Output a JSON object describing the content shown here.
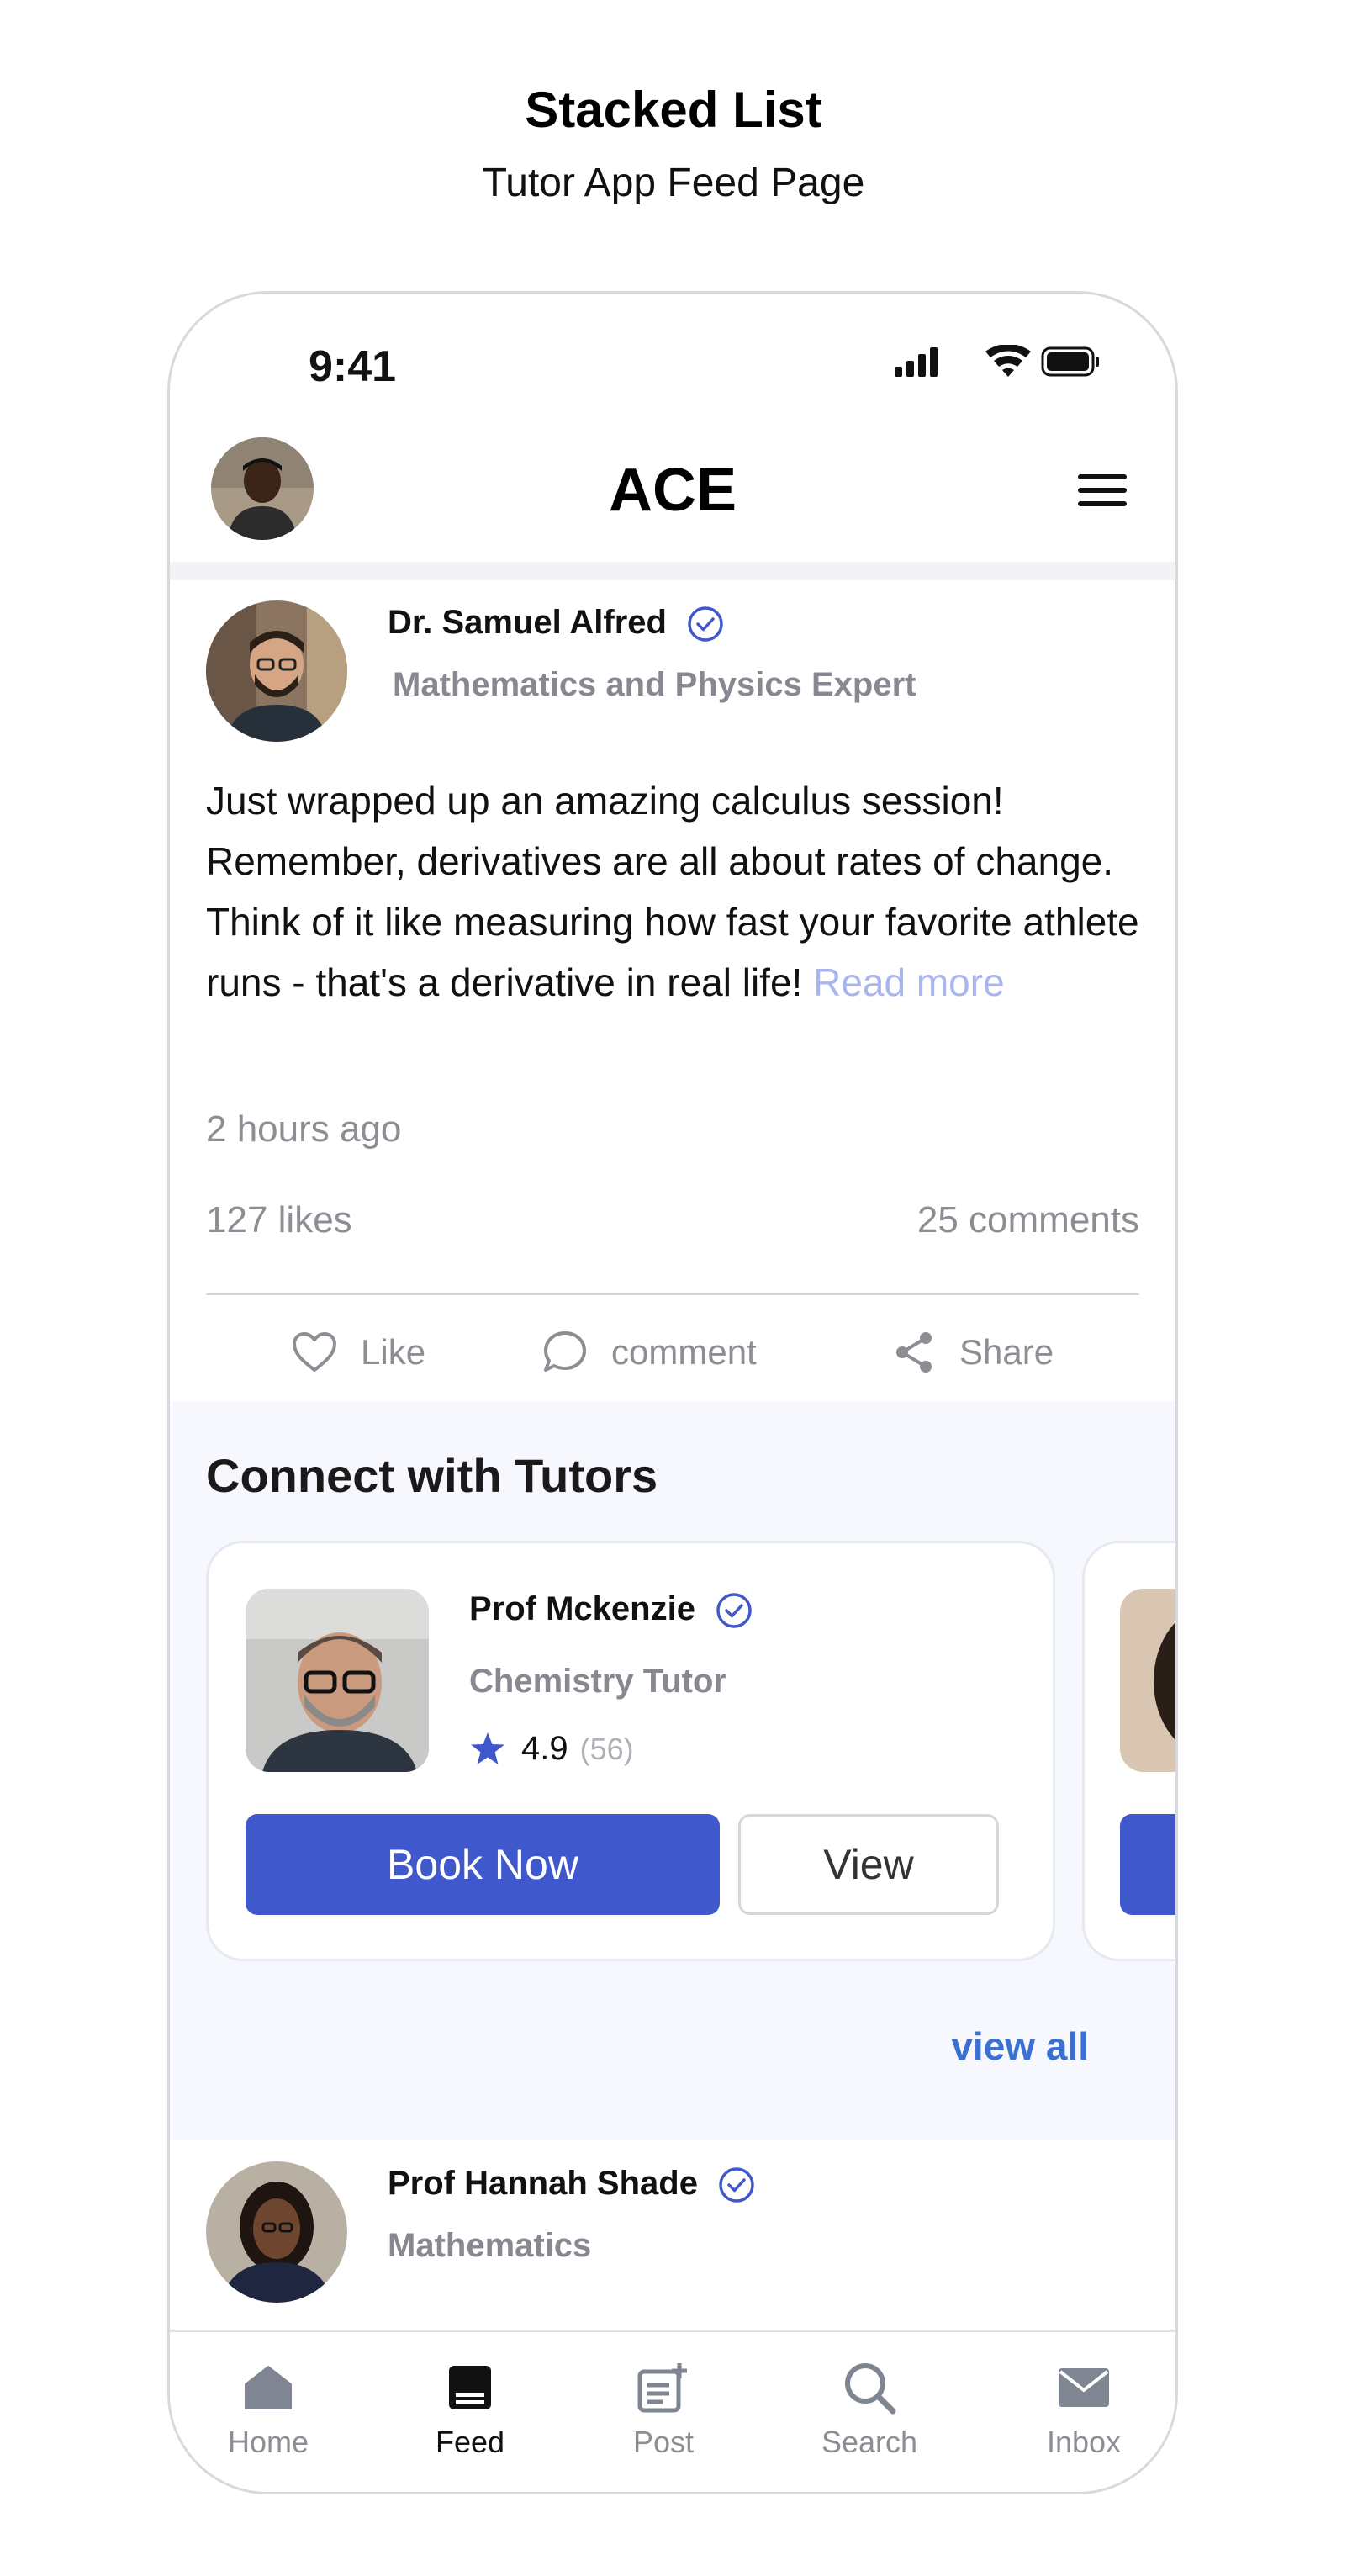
{
  "header": {
    "title": "Stacked List",
    "subtitle": "Tutor App Feed Page"
  },
  "status_bar": {
    "time": "9:41"
  },
  "app_bar": {
    "title": "ACE",
    "menu_icon": "hamburger-menu-icon"
  },
  "post": {
    "author": "Dr. Samuel Alfred",
    "role": "Mathematics and Physics Expert",
    "body": "Just wrapped up an amazing calculus session! Remember, derivatives are all about rates of change. Think of it like measuring how fast your favorite athlete runs - that's a derivative in real life!",
    "read_more": "Read more",
    "time": "2 hours ago",
    "likes": "127 likes",
    "comments": "25 comments",
    "actions": {
      "like": "Like",
      "comment": "comment",
      "share": "Share"
    }
  },
  "connect": {
    "title": "Connect with Tutors",
    "tutor": {
      "name": "Prof Mckenzie",
      "subject": "Chemistry Tutor",
      "rating": "4.9",
      "reviews": "(56)",
      "book_label": "Book Now",
      "view_label": "View"
    },
    "view_all": "view all"
  },
  "post2": {
    "author": "Prof Hannah Shade",
    "role": "Mathematics"
  },
  "tabs": [
    {
      "label": "Home",
      "icon": "home-icon"
    },
    {
      "label": "Feed",
      "icon": "feed-icon"
    },
    {
      "label": "Post",
      "icon": "post-icon"
    },
    {
      "label": "Search",
      "icon": "search-icon"
    },
    {
      "label": "Inbox",
      "icon": "inbox-icon"
    }
  ],
  "colors": {
    "accent": "#3f58cc",
    "link": "#3a6fd3",
    "muted": "#8d8d94",
    "verified": "#3f58cc"
  }
}
